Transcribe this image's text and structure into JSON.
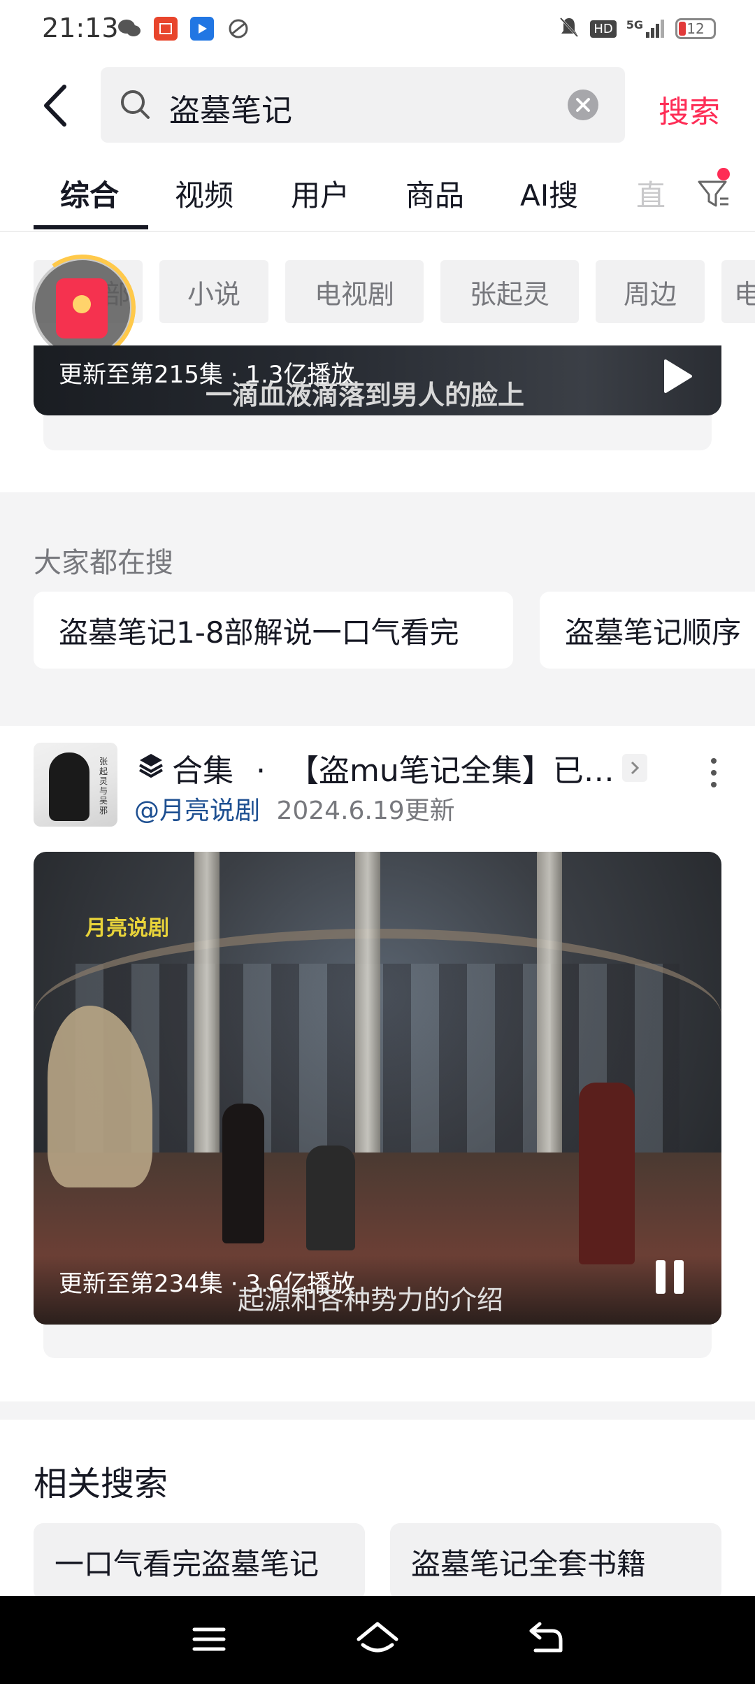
{
  "status_bar": {
    "time": "21:13",
    "left_icons": [
      "wechat-icon",
      "listen-app-icon",
      "tencent-video-icon",
      "browser-icon"
    ],
    "right_icons": [
      "mute-icon",
      "hd-icon",
      "5g-signal-icon",
      "battery-icon"
    ],
    "battery_level": "12",
    "hd_label": "HD",
    "signal_label": "5G"
  },
  "search": {
    "query": "盗墓笔记",
    "submit_label": "搜索"
  },
  "tabs": [
    "综合",
    "视频",
    "用户",
    "商品",
    "AI搜",
    "直"
  ],
  "chips": [
    "小说",
    "电视剧",
    "张起灵",
    "周边",
    "电"
  ],
  "chip_partial": "部",
  "top_video": {
    "meta": "更新至第215集 · 1.3亿播放",
    "subtitle": "一滴血液滴落到男人的脸上"
  },
  "everyone_searches": {
    "title": "大家都在搜",
    "items": [
      "盗墓笔记1-8部解说一口气看完",
      "盗墓笔记顺序"
    ]
  },
  "collection": {
    "type_label": "合集",
    "title": "【盗mu笔记全集】已…",
    "author": "@月亮说剧",
    "updated": "2024.6.19更新",
    "avatar_text": "张起灵与吴邪",
    "logo_text": "月亮说剧",
    "video_meta": "更新至第234集 · 3.6亿播放",
    "video_subtitle": "起源和各种势力的介绍"
  },
  "related": {
    "title": "相关搜索",
    "items": [
      "一口气看完盗墓笔记",
      "盗墓笔记全套书籍"
    ]
  },
  "colors": {
    "accent": "#fe2c55",
    "text": "#161823",
    "muted": "#77787d",
    "chip_bg": "#f1f1f2",
    "author_link": "#1d4f91"
  }
}
